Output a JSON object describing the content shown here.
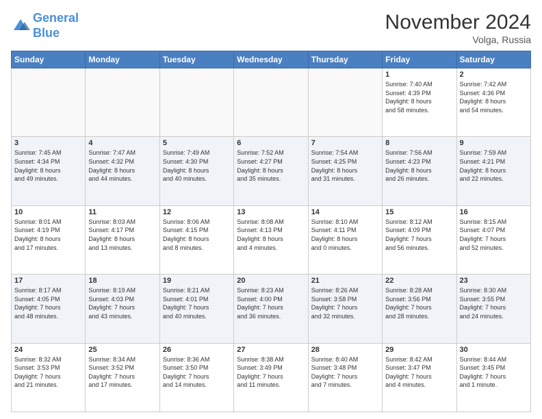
{
  "header": {
    "logo_line1": "General",
    "logo_line2": "Blue",
    "month": "November 2024",
    "location": "Volga, Russia"
  },
  "days_of_week": [
    "Sunday",
    "Monday",
    "Tuesday",
    "Wednesday",
    "Thursday",
    "Friday",
    "Saturday"
  ],
  "weeks": [
    [
      {
        "day": "",
        "info": ""
      },
      {
        "day": "",
        "info": ""
      },
      {
        "day": "",
        "info": ""
      },
      {
        "day": "",
        "info": ""
      },
      {
        "day": "",
        "info": ""
      },
      {
        "day": "1",
        "info": "Sunrise: 7:40 AM\nSunset: 4:39 PM\nDaylight: 8 hours\nand 58 minutes."
      },
      {
        "day": "2",
        "info": "Sunrise: 7:42 AM\nSunset: 4:36 PM\nDaylight: 8 hours\nand 54 minutes."
      }
    ],
    [
      {
        "day": "3",
        "info": "Sunrise: 7:45 AM\nSunset: 4:34 PM\nDaylight: 8 hours\nand 49 minutes."
      },
      {
        "day": "4",
        "info": "Sunrise: 7:47 AM\nSunset: 4:32 PM\nDaylight: 8 hours\nand 44 minutes."
      },
      {
        "day": "5",
        "info": "Sunrise: 7:49 AM\nSunset: 4:30 PM\nDaylight: 8 hours\nand 40 minutes."
      },
      {
        "day": "6",
        "info": "Sunrise: 7:52 AM\nSunset: 4:27 PM\nDaylight: 8 hours\nand 35 minutes."
      },
      {
        "day": "7",
        "info": "Sunrise: 7:54 AM\nSunset: 4:25 PM\nDaylight: 8 hours\nand 31 minutes."
      },
      {
        "day": "8",
        "info": "Sunrise: 7:56 AM\nSunset: 4:23 PM\nDaylight: 8 hours\nand 26 minutes."
      },
      {
        "day": "9",
        "info": "Sunrise: 7:59 AM\nSunset: 4:21 PM\nDaylight: 8 hours\nand 22 minutes."
      }
    ],
    [
      {
        "day": "10",
        "info": "Sunrise: 8:01 AM\nSunset: 4:19 PM\nDaylight: 8 hours\nand 17 minutes."
      },
      {
        "day": "11",
        "info": "Sunrise: 8:03 AM\nSunset: 4:17 PM\nDaylight: 8 hours\nand 13 minutes."
      },
      {
        "day": "12",
        "info": "Sunrise: 8:06 AM\nSunset: 4:15 PM\nDaylight: 8 hours\nand 8 minutes."
      },
      {
        "day": "13",
        "info": "Sunrise: 8:08 AM\nSunset: 4:13 PM\nDaylight: 8 hours\nand 4 minutes."
      },
      {
        "day": "14",
        "info": "Sunrise: 8:10 AM\nSunset: 4:11 PM\nDaylight: 8 hours\nand 0 minutes."
      },
      {
        "day": "15",
        "info": "Sunrise: 8:12 AM\nSunset: 4:09 PM\nDaylight: 7 hours\nand 56 minutes."
      },
      {
        "day": "16",
        "info": "Sunrise: 8:15 AM\nSunset: 4:07 PM\nDaylight: 7 hours\nand 52 minutes."
      }
    ],
    [
      {
        "day": "17",
        "info": "Sunrise: 8:17 AM\nSunset: 4:05 PM\nDaylight: 7 hours\nand 48 minutes."
      },
      {
        "day": "18",
        "info": "Sunrise: 8:19 AM\nSunset: 4:03 PM\nDaylight: 7 hours\nand 43 minutes."
      },
      {
        "day": "19",
        "info": "Sunrise: 8:21 AM\nSunset: 4:01 PM\nDaylight: 7 hours\nand 40 minutes."
      },
      {
        "day": "20",
        "info": "Sunrise: 8:23 AM\nSunset: 4:00 PM\nDaylight: 7 hours\nand 36 minutes."
      },
      {
        "day": "21",
        "info": "Sunrise: 8:26 AM\nSunset: 3:58 PM\nDaylight: 7 hours\nand 32 minutes."
      },
      {
        "day": "22",
        "info": "Sunrise: 8:28 AM\nSunset: 3:56 PM\nDaylight: 7 hours\nand 28 minutes."
      },
      {
        "day": "23",
        "info": "Sunrise: 8:30 AM\nSunset: 3:55 PM\nDaylight: 7 hours\nand 24 minutes."
      }
    ],
    [
      {
        "day": "24",
        "info": "Sunrise: 8:32 AM\nSunset: 3:53 PM\nDaylight: 7 hours\nand 21 minutes."
      },
      {
        "day": "25",
        "info": "Sunrise: 8:34 AM\nSunset: 3:52 PM\nDaylight: 7 hours\nand 17 minutes."
      },
      {
        "day": "26",
        "info": "Sunrise: 8:36 AM\nSunset: 3:50 PM\nDaylight: 7 hours\nand 14 minutes."
      },
      {
        "day": "27",
        "info": "Sunrise: 8:38 AM\nSunset: 3:49 PM\nDaylight: 7 hours\nand 11 minutes."
      },
      {
        "day": "28",
        "info": "Sunrise: 8:40 AM\nSunset: 3:48 PM\nDaylight: 7 hours\nand 7 minutes."
      },
      {
        "day": "29",
        "info": "Sunrise: 8:42 AM\nSunset: 3:47 PM\nDaylight: 7 hours\nand 4 minutes."
      },
      {
        "day": "30",
        "info": "Sunrise: 8:44 AM\nSunset: 3:45 PM\nDaylight: 7 hours\nand 1 minute."
      }
    ]
  ]
}
